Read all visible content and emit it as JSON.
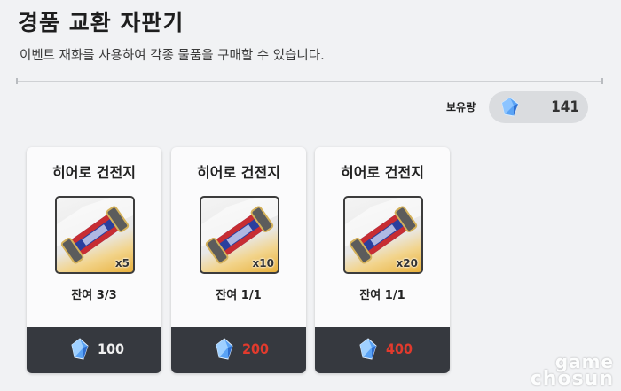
{
  "header": {
    "title": "경품 교환 자판기",
    "subtitle": "이벤트 재화를 사용하여 각종 물품을 구매할 수 있습니다."
  },
  "balance": {
    "label": "보유량",
    "value": "141",
    "icon": "blue-crystal-icon"
  },
  "items": [
    {
      "name": "히어로 건전지",
      "quantity": "x5",
      "stock": "잔여 3/3",
      "price": "100",
      "price_color": "#f0f0f0",
      "icon": "battery-icon"
    },
    {
      "name": "히어로 건전지",
      "quantity": "x10",
      "stock": "잔여 1/1",
      "price": "200",
      "price_color": "#e23a2d",
      "icon": "battery-icon"
    },
    {
      "name": "히어로 건전지",
      "quantity": "x20",
      "stock": "잔여 1/1",
      "price": "400",
      "price_color": "#e23a2d",
      "icon": "battery-icon"
    }
  ],
  "watermark": {
    "line1": "game",
    "line2": "chosun"
  },
  "colors": {
    "background": "#f1f2f4",
    "card": "#fbfbfc",
    "price_bar": "#36393f",
    "accent_gold": "#e9b13c",
    "crystal": "#4a8fe8"
  }
}
